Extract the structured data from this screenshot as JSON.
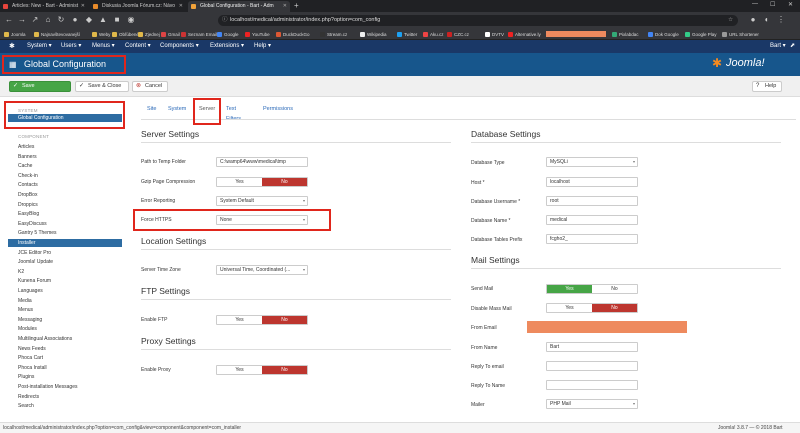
{
  "browser": {
    "tabs": [
      {
        "title": "Articles: New - Bart - Administ"
      },
      {
        "title": "Diskusia Joomla Fórum.cz: Návo"
      },
      {
        "title": "Global Configuration - Bart - Adm"
      }
    ],
    "url": "localhost/medical/administrator/index.php?option=com_config",
    "bookmarks": [
      "Joomla",
      "Najnavštevovanejší",
      "Weby",
      "Obľúbené",
      "Zjednej",
      "Gmail",
      "Seznam Email",
      "Google",
      "YouTube",
      "DuckDuckGo",
      "Stream.cz",
      "Wikipedia",
      "Twitter",
      "Aku.cz",
      "CZC.cz",
      "DVTV",
      "Alternative.ly",
      "Pixlabdac",
      "Dok Google",
      "Google Play",
      "URL Shortener"
    ]
  },
  "joomla_menu": {
    "items": [
      "System",
      "Users",
      "Menus",
      "Content",
      "Components",
      "Extensions",
      "Help"
    ],
    "user": "Bart"
  },
  "header": {
    "title": "Global Configuration",
    "logo": "Joomla!"
  },
  "toolbar": {
    "save": "Save",
    "save_close": "Save & Close",
    "cancel": "Cancel",
    "help": "Help"
  },
  "sidebar": {
    "system_heading": "SYSTEM",
    "active_item": "Global Configuration",
    "component_heading": "COMPONENT",
    "components": [
      "Articles",
      "Banners",
      "Cache",
      "Check-in",
      "Contacts",
      "DropBox",
      "Droppics",
      "EasyBlog",
      "EasyDiscuss",
      "Gantry 5 Themes",
      "Installer",
      "JCE Editor Pro",
      "Joomla! Update",
      "K2",
      "Kunena Forum",
      "Languages",
      "Media",
      "Menus",
      "Messaging",
      "Modules",
      "Multilingual Associations",
      "News Feeds",
      "Phoca Cart",
      "Phoca Install",
      "Plugins",
      "Post-installation Messages",
      "Redirects",
      "Search"
    ],
    "highlighted": "Installer"
  },
  "tabs": [
    "Site",
    "System",
    "Server",
    "Text Filters",
    "Permissions"
  ],
  "active_tab": "Server",
  "server": {
    "heading": "Server Settings",
    "temp_path_label": "Path to Temp Folder",
    "temp_path_value": "C:\\wamp64\\www\\medical\\tmp",
    "gzip_label": "Gzip Page Compression",
    "error_label": "Error Reporting",
    "error_value": "System Default",
    "https_label": "Force HTTPS",
    "https_value": "None"
  },
  "location": {
    "heading": "Location Settings",
    "tz_label": "Server Time Zone",
    "tz_value": "Universal Time, Coordinated (..."
  },
  "ftp": {
    "heading": "FTP Settings",
    "enable_label": "Enable FTP"
  },
  "proxy": {
    "heading": "Proxy Settings",
    "enable_label": "Enable Proxy"
  },
  "database": {
    "heading": "Database Settings",
    "type_label": "Database Type",
    "type_value": "MySQLi",
    "host_label": "Host *",
    "host_value": "localhost",
    "user_label": "Database Username *",
    "user_value": "root",
    "name_label": "Database Name *",
    "name_value": "medical",
    "prefix_label": "Database Tables Prefix",
    "prefix_value": "fcgho2_"
  },
  "mail": {
    "heading": "Mail Settings",
    "send_label": "Send Mail",
    "mass_label": "Disable Mass Mail",
    "from_email_label": "From Email",
    "from_name_label": "From Name",
    "from_name_value": "Bart",
    "reply_email_label": "Reply To email",
    "reply_name_label": "Reply To Name",
    "mailer_label": "Mailer",
    "mailer_value": "PHP Mail"
  },
  "toggle": {
    "yes": "Yes",
    "no": "No"
  },
  "status": {
    "url": "localhost/medical/administrator/index.php?option=com_config&view=component&component=com_installer",
    "version": "Joomla! 3.8.7 — © 2018 Bart"
  },
  "colors": {
    "header": "#17568c",
    "topmenu": "#1a3867",
    "save_green": "#46a546",
    "no_red": "#bd362f",
    "annotation_red": "#e0261c",
    "redacted": "#ee8a5e"
  }
}
